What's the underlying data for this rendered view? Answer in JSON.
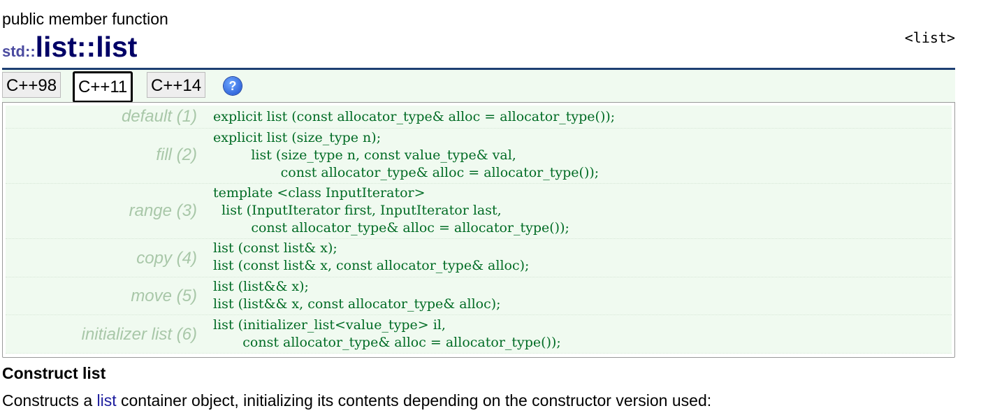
{
  "header": {
    "kind": "public member function",
    "namespace": "std::",
    "name": "list::list",
    "header_ref": "<list>"
  },
  "tabs": [
    {
      "label": "C++98",
      "active": false
    },
    {
      "label": "C++11",
      "active": true
    },
    {
      "label": "C++14",
      "active": false
    }
  ],
  "help_icon": "question-icon",
  "prototypes": [
    {
      "label": "default (1)",
      "code": "explicit list (const allocator_type& alloc = allocator_type());"
    },
    {
      "label": "fill (2)",
      "code": "explicit list (size_type n);\n         list (size_type n, const value_type& val,\n                const allocator_type& alloc = allocator_type());"
    },
    {
      "label": "range (3)",
      "code": "template <class InputIterator>\n  list (InputIterator first, InputIterator last,\n         const allocator_type& alloc = allocator_type());"
    },
    {
      "label": "copy (4)",
      "code": "list (const list& x);\nlist (const list& x, const allocator_type& alloc);"
    },
    {
      "label": "move (5)",
      "code": "list (list&& x);\nlist (list&& x, const allocator_type& alloc);"
    },
    {
      "label": "initializer list (6)",
      "code": "list (initializer_list<value_type> il,\n       const allocator_type& alloc = allocator_type());"
    }
  ],
  "section": {
    "title": "Construct list",
    "desc_before": "Constructs a ",
    "desc_link": "list",
    "desc_after": " container object, initializing its contents depending on the constructor version used:"
  },
  "colors": {
    "title": "#000066",
    "namespace": "#4b4ba0",
    "rule": "#1e3f72",
    "code": "#006b24",
    "label": "#a8c7a8",
    "row_bg": "#f0faf0",
    "link": "#1d1d9e"
  }
}
